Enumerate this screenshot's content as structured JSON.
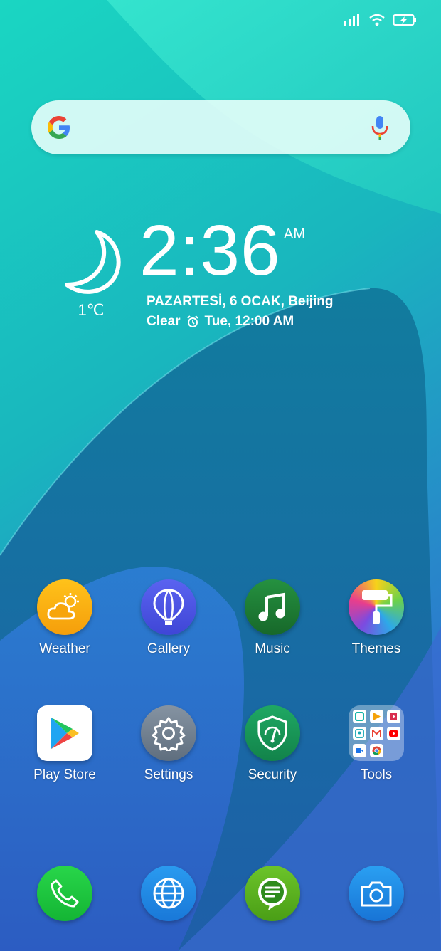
{
  "status_bar": {
    "signal_icon": "signal-bars-icon",
    "wifi_icon": "wifi-icon",
    "battery_icon": "battery-charging-icon"
  },
  "search": {
    "logo_icon": "google-g-logo-icon",
    "mic_icon": "microphone-icon"
  },
  "weather": {
    "icon": "moon-icon",
    "temperature": "1℃"
  },
  "clock": {
    "time": "2:36",
    "ampm": "AM",
    "date_location": "PAZARTESİ, 6 OCAK, Beijing",
    "condition": "Clear",
    "alarm_icon": "alarm-clock-icon",
    "next_alarm": "Tue, 12:00 AM"
  },
  "apps_row1": [
    {
      "label": "Weather",
      "icon": "weather-icon",
      "color": "#F7A50C"
    },
    {
      "label": "Gallery",
      "icon": "balloon-icon",
      "color": "#4C55E6"
    },
    {
      "label": "Music",
      "icon": "music-note-icon",
      "color": "#1C7A32"
    },
    {
      "label": "Themes",
      "icon": "paint-roller-icon",
      "color": "#E84A8E"
    }
  ],
  "apps_row2": [
    {
      "label": "Play Store",
      "icon": "play-store-icon",
      "color": "#FFFFFF"
    },
    {
      "label": "Settings",
      "icon": "gear-icon",
      "color": "#6E7E8E"
    },
    {
      "label": "Security",
      "icon": "shield-icon",
      "color": "#169A58"
    },
    {
      "label": "Tools",
      "icon": "folder-icon",
      "color": "#FFFFFF"
    }
  ],
  "dock": [
    {
      "icon": "phone-icon",
      "color": "#1FCB3E"
    },
    {
      "icon": "globe-icon",
      "color": "#1D8FE6"
    },
    {
      "icon": "chat-bubble-icon",
      "color": "#5EB320"
    },
    {
      "icon": "camera-icon",
      "color": "#1E90E8"
    }
  ]
}
